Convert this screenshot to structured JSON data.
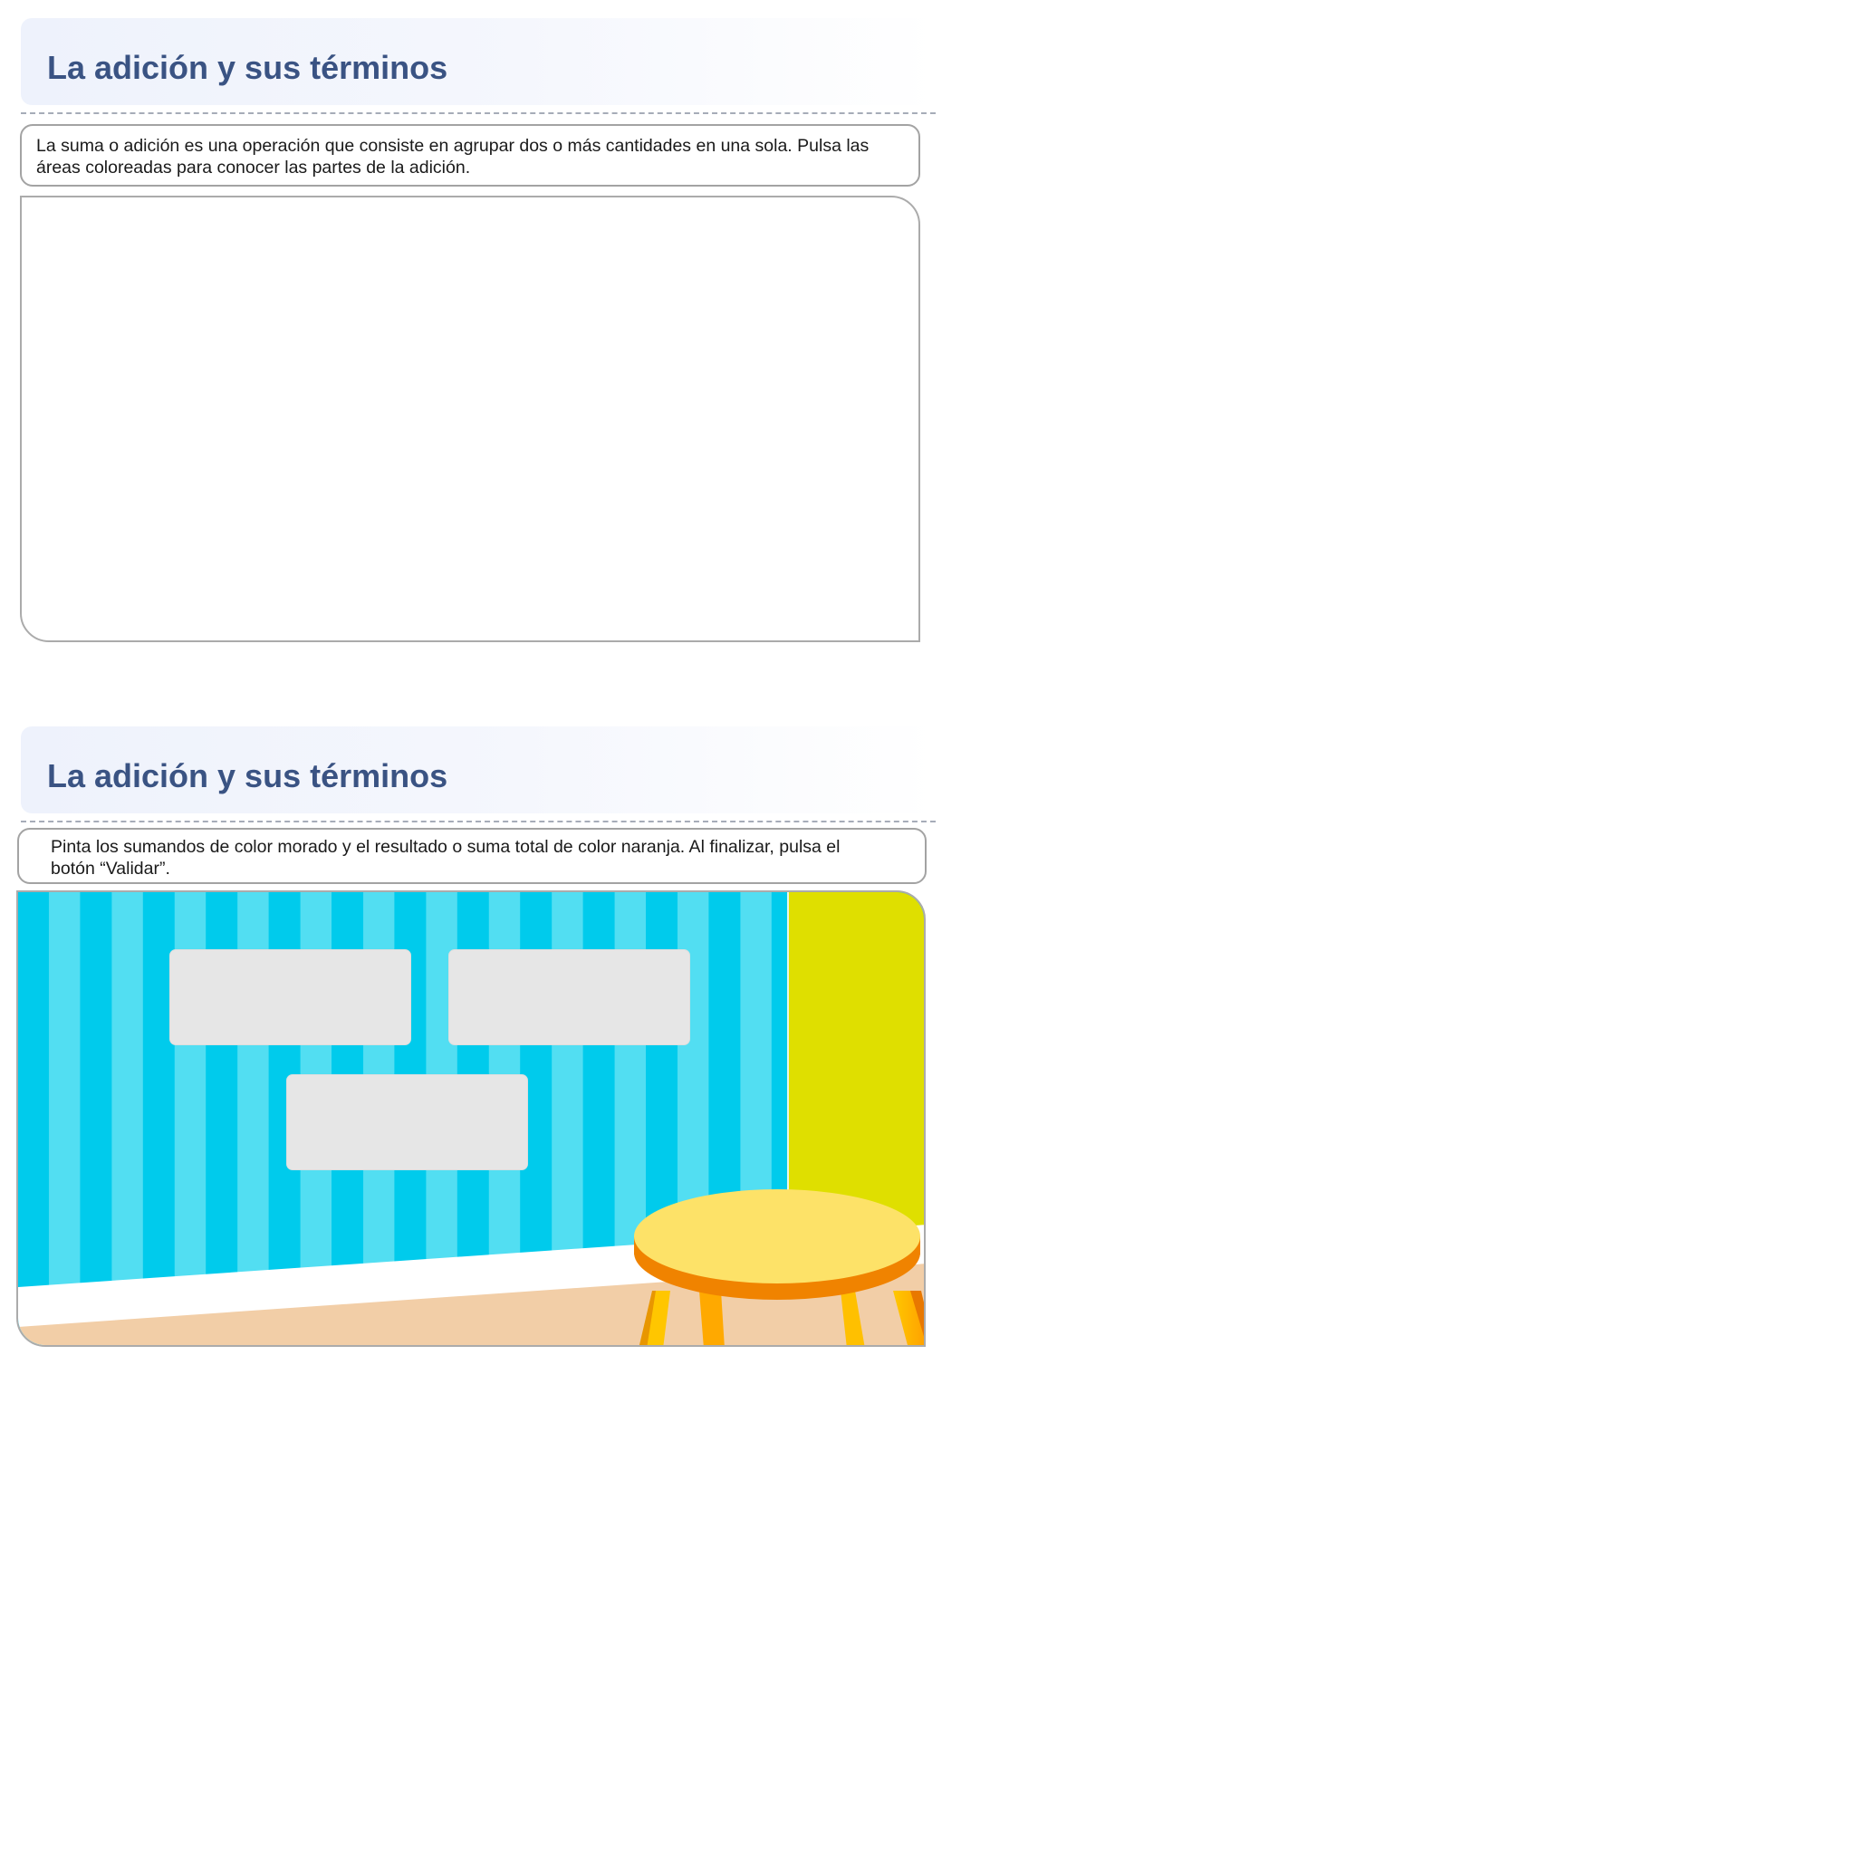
{
  "screen1": {
    "title": "La adición y sus términos",
    "instruction": "La suma o adición es una operación que consiste en agrupar dos o más cantidades en una sola. Pulsa las áreas coloreadas para conocer las partes de la adición."
  },
  "screen2": {
    "title": "La adición y sus términos",
    "instruction": "Pinta los sumandos de color morado y el resultado o suma total de color naranja. Al finalizar, pulsa el botón “Validar”.",
    "answer_boxes": [
      "",
      "",
      ""
    ]
  },
  "colors": {
    "title_text": "#3a5383",
    "wall_stripe_dark": "#00cbec",
    "wall_stripe_light": "#52def2",
    "side_wall": "#dfdf00",
    "floor": "#f2cea7",
    "answer_box": "#e6e6e6",
    "stool_top": "#fde268",
    "stool_rim": "#f08300",
    "stool_legs": "#ffb000"
  }
}
